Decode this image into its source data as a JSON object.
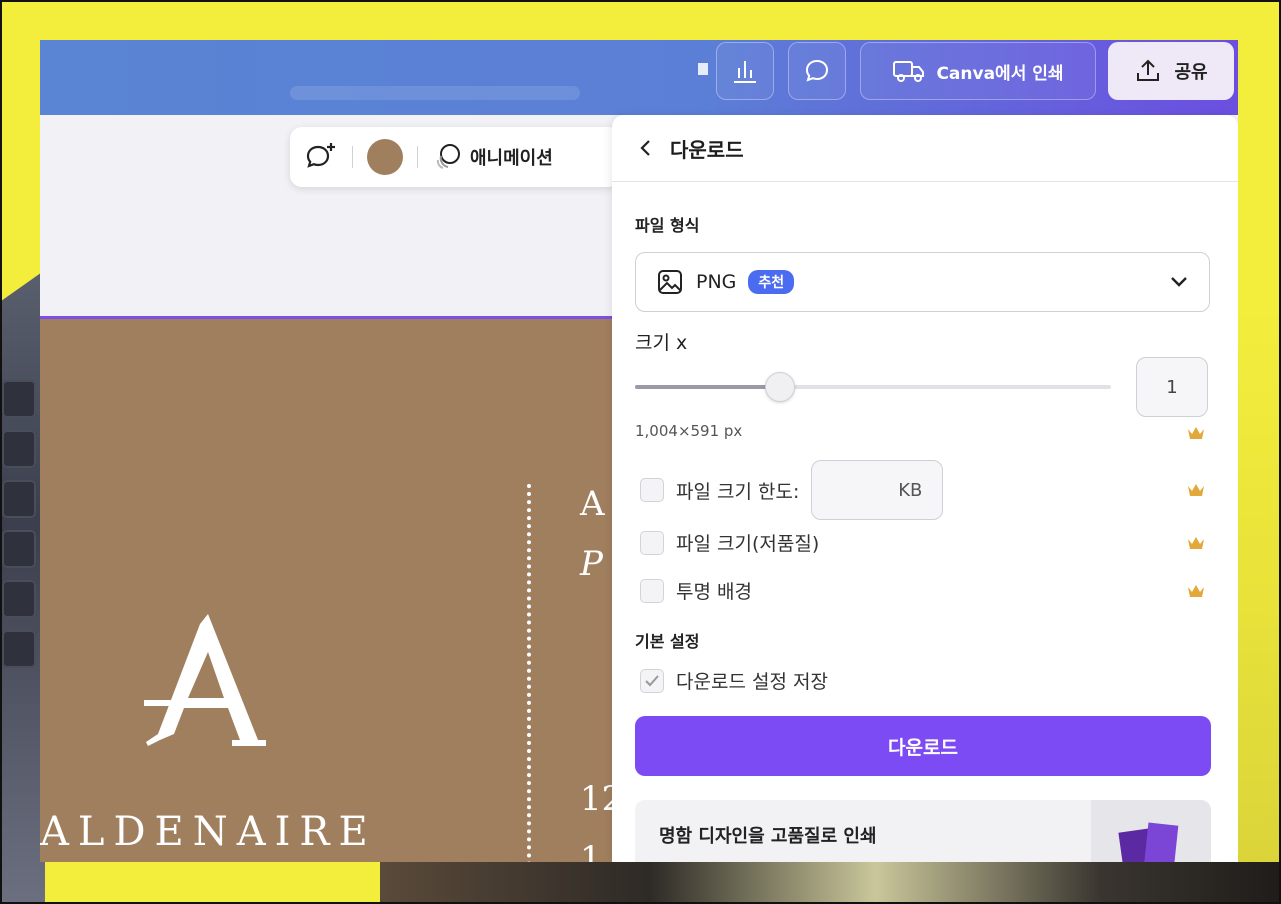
{
  "topbar": {
    "print_label": "Canva에서 인쇄",
    "share_label": "공유"
  },
  "toolbar": {
    "animation_label": "애니메이션",
    "color_swatch": "#a07f5e"
  },
  "design": {
    "logo_letter": "A",
    "brand_name": "ALDENAIRE",
    "text_line1": "A",
    "text_line2": "P",
    "text_line3": "12",
    "text_line4": "1"
  },
  "panel": {
    "title": "다운로드",
    "file_type_label": "파일 형식",
    "file_type_value": "PNG",
    "file_type_badge": "추천",
    "size_label": "크기 x",
    "scale": 1,
    "scale_text": "1",
    "scale_min": 0.125,
    "scale_max": 3,
    "dimensions": "1,004×591 px",
    "options": {
      "limit_label": "파일 크기 한도:",
      "limit_unit": "KB",
      "low_quality_label": "파일 크기(저품질)",
      "transparent_label": "투명 배경"
    },
    "defaults_label": "기본 설정",
    "save_settings_label": "다운로드 설정 저장",
    "download_button": "다운로드",
    "promo_text": "명함 디자인을 고품질로 인쇄"
  },
  "colors": {
    "accent": "#7d4bf3",
    "badge": "#4b6cf0",
    "design_bg": "#a07f5e",
    "crown": "#e3a83a"
  }
}
